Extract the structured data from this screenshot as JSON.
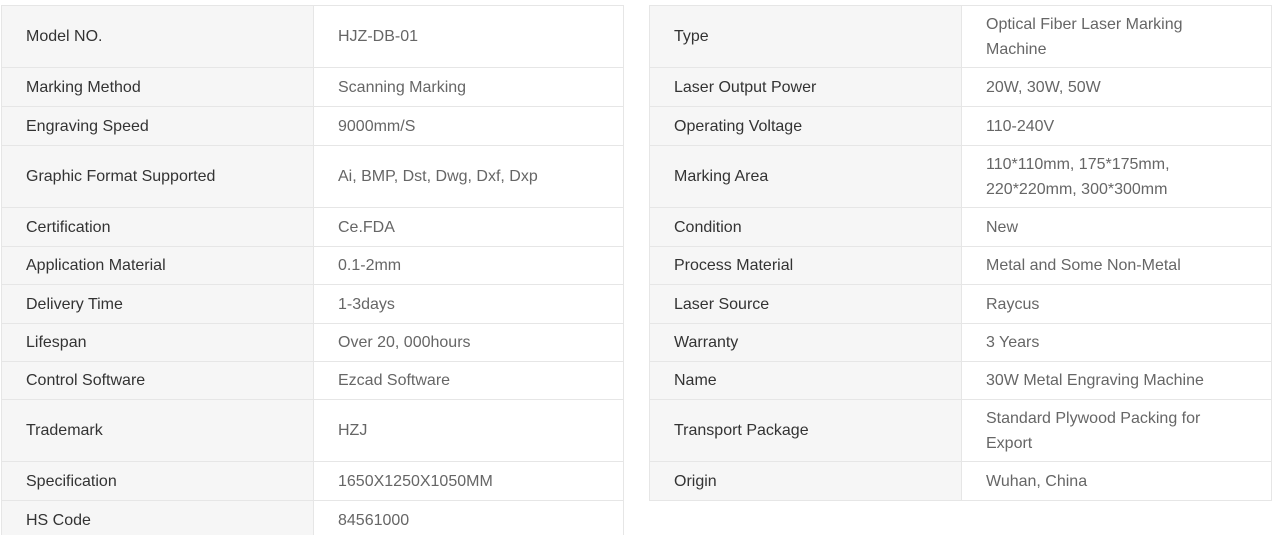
{
  "left_table": {
    "rows": [
      {
        "label": "Model NO.",
        "value": "HJZ-DB-01"
      },
      {
        "label": "Marking Method",
        "value": "Scanning Marking"
      },
      {
        "label": "Engraving Speed",
        "value": "9000mm/S"
      },
      {
        "label": "Graphic Format Supported",
        "value": "Ai, BMP, Dst, Dwg, Dxf, Dxp"
      },
      {
        "label": "Certification",
        "value": "Ce.FDA"
      },
      {
        "label": "Application Material",
        "value": "0.1-2mm"
      },
      {
        "label": "Delivery Time",
        "value": "1-3days"
      },
      {
        "label": "Lifespan",
        "value": "Over 20, 000hours"
      },
      {
        "label": "Control Software",
        "value": "Ezcad Software"
      },
      {
        "label": "Trademark",
        "value": "HZJ"
      },
      {
        "label": "Specification",
        "value": "1650X1250X1050MM"
      },
      {
        "label": "HS Code",
        "value": "84561000"
      }
    ]
  },
  "right_table": {
    "rows": [
      {
        "label": "Type",
        "value": "Optical Fiber Laser Marking Machine"
      },
      {
        "label": "Laser Output Power",
        "value": "20W, 30W, 50W"
      },
      {
        "label": "Operating Voltage",
        "value": "110-240V"
      },
      {
        "label": "Marking Area",
        "value": "110*110mm, 175*175mm, 220*220mm, 300*300mm"
      },
      {
        "label": "Condition",
        "value": "New"
      },
      {
        "label": "Process Material",
        "value": "Metal and Some Non-Metal"
      },
      {
        "label": "Laser Source",
        "value": "Raycus"
      },
      {
        "label": "Warranty",
        "value": "3 Years"
      },
      {
        "label": "Name",
        "value": "30W Metal Engraving Machine"
      },
      {
        "label": "Transport Package",
        "value": "Standard Plywood Packing for Export"
      },
      {
        "label": "Origin",
        "value": "Wuhan, China"
      }
    ]
  }
}
